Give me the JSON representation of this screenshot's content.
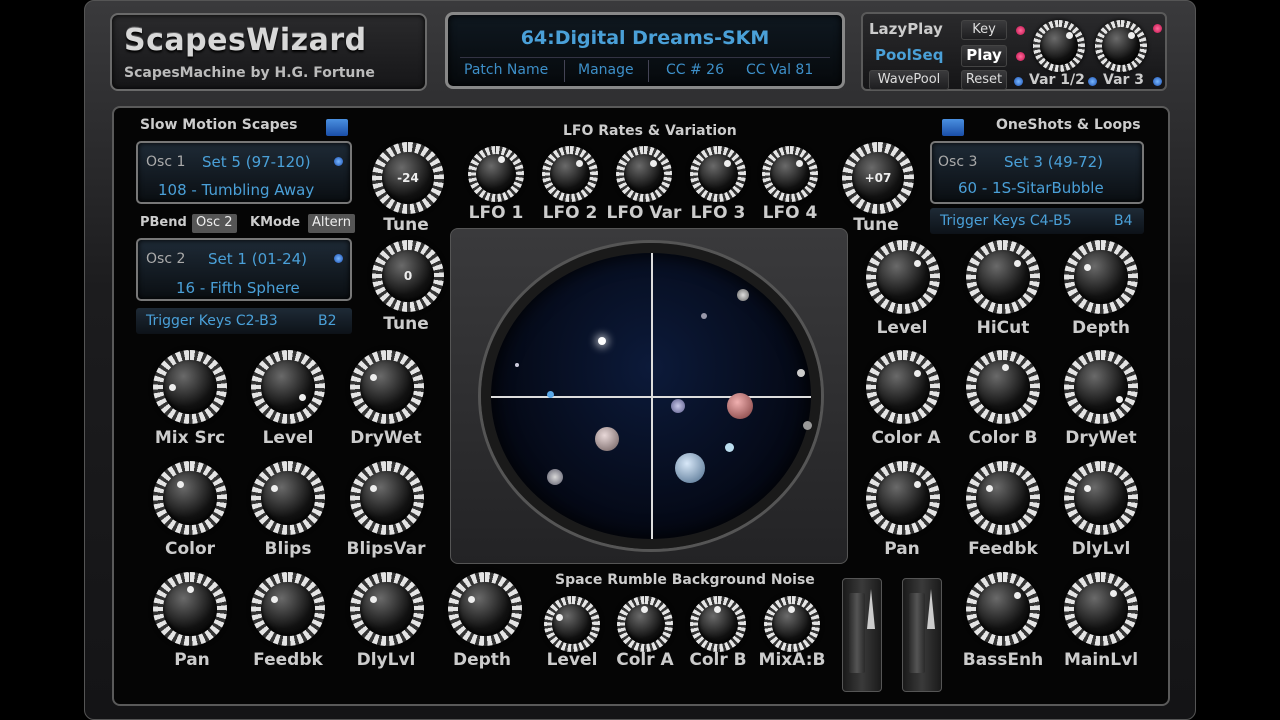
{
  "header": {
    "logo_title": "ScapesWizard",
    "logo_subtitle": "ScapesMachine by H.G. Fortune"
  },
  "display": {
    "patch": "64:Digital Dreams-SKM",
    "buttons": [
      "Patch Name",
      "Manage"
    ],
    "cc_label": "CC # 26",
    "ccval_label": "CC Val 81"
  },
  "topright": {
    "lazyplay": "LazyPlay",
    "poolseq": "PoolSeq",
    "wavepool": "WavePool",
    "key": "Key",
    "play": "Play",
    "reset": "Reset",
    "var12": "Var 1/2",
    "var3": "Var 3"
  },
  "left": {
    "section": "Slow Motion Scapes",
    "osc1": {
      "label": "Osc 1",
      "set": "Set 5 (97-120)",
      "sample": "108 - Tumbling Away"
    },
    "tabs": [
      "PBend",
      "Osc 2",
      "KMode",
      "Altern"
    ],
    "osc2": {
      "label": "Osc 2",
      "set": "Set 1 (01-24)",
      "sample": "16 - Fifth Sphere"
    },
    "trigger": {
      "label": "Trigger Keys C2-B3",
      "key": "B2"
    }
  },
  "right": {
    "section": "OneShots & Loops",
    "osc3": {
      "label": "Osc 3",
      "set": "Set 3 (49-72)",
      "sample": "60 - 1S-SitarBubble"
    },
    "trigger": {
      "label": "Trigger Keys C4-B5",
      "key": "B4"
    }
  },
  "lfo": {
    "section": "LFO Rates & Variation",
    "knobs": [
      "LFO 1",
      "LFO 2",
      "LFO Var",
      "LFO 3",
      "LFO 4"
    ]
  },
  "tune": {
    "label": "Tune",
    "val_left": "-24",
    "val_left2": "0",
    "val_right": "+07"
  },
  "left_knobs": {
    "row1": [
      "Mix Src",
      "Level",
      "DryWet"
    ],
    "row2": [
      "Color",
      "Blips",
      "BlipsVar"
    ],
    "row3": [
      "Pan",
      "Feedbk",
      "DlyLvl",
      "Depth"
    ]
  },
  "right_knobs": {
    "row1": [
      "Level",
      "HiCut",
      "Depth"
    ],
    "row2": [
      "Color A",
      "Color B",
      "DryWet"
    ],
    "row3": [
      "Pan",
      "Feedbk",
      "DlyLvl"
    ],
    "row4": [
      "BassEnh",
      "MainLvl"
    ]
  },
  "noise": {
    "section": "Space Rumble Background Noise",
    "knobs": [
      "Level",
      "Colr A",
      "Colr B",
      "MixA:B"
    ]
  },
  "colors": {
    "accent_blue": "#4aa0d8",
    "led_red": "#e0205c",
    "led_blue": "#2a6ed0"
  }
}
